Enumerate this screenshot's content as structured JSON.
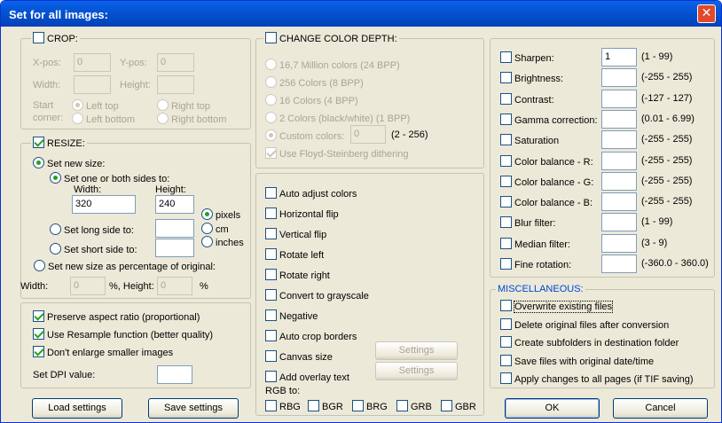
{
  "title": "Set for all images:",
  "close_glyph": "✕",
  "crop": {
    "label": "CROP:",
    "xpos_label": "X-pos:",
    "xpos": "0",
    "ypos_label": "Y-pos:",
    "ypos": "0",
    "width_label": "Width:",
    "height_label": "Height:",
    "start_label": "Start",
    "corner_label": "corner:",
    "left_top": "Left top",
    "right_top": "Right top",
    "left_bottom": "Left bottom",
    "right_bottom": "Right bottom"
  },
  "resize": {
    "label": "RESIZE:",
    "set_new_size": "Set new size:",
    "set_sides": "Set one or both sides to:",
    "width_label": "Width:",
    "height_label": "Height:",
    "width": "320",
    "height": "240",
    "pixels": "pixels",
    "cm": "cm",
    "inches": "inches",
    "long_side": "Set long side to:",
    "short_side": "Set short side to:",
    "percentage": "Set new size as percentage of original:",
    "pct_width_label": "Width:",
    "pct_width": "0",
    "pct_mid": "%, Height:",
    "pct_height": "0",
    "pct_end": "%"
  },
  "options": {
    "preserve": "Preserve aspect ratio (proportional)",
    "resample": "Use Resample function (better quality)",
    "dont_enlarge": "Don't enlarge smaller images",
    "dpi_label": "Set DPI value:"
  },
  "buttons": {
    "load": "Load settings",
    "save": "Save settings",
    "ok": "OK",
    "cancel": "Cancel",
    "settings1": "Settings",
    "settings2": "Settings"
  },
  "color_depth": {
    "label": "CHANGE COLOR DEPTH:",
    "c24": "16,7 Million colors (24 BPP)",
    "c8": "256 Colors (8 BPP)",
    "c4": "16 Colors (4 BPP)",
    "c1": "2 Colors (black/white) (1 BPP)",
    "custom": "Custom colors:",
    "custom_value": "0",
    "custom_range": "(2 - 256)",
    "dither": "Use Floyd-Steinberg dithering"
  },
  "transforms": {
    "auto_adjust": "Auto adjust colors",
    "hflip": "Horizontal flip",
    "vflip": "Vertical flip",
    "rot_left": "Rotate left",
    "rot_right": "Rotate right",
    "grayscale": "Convert to grayscale",
    "negative": "Negative",
    "autocrop": "Auto crop borders",
    "canvas": "Canvas size",
    "overlay": "Add overlay text",
    "rgb_label": "RGB to:",
    "rbg": "RBG",
    "bgr": "BGR",
    "brg": "BRG",
    "grb": "GRB",
    "gbr": "GBR"
  },
  "adjust": [
    {
      "label": "Sharpen:",
      "value": "1",
      "range": "(1 - 99)"
    },
    {
      "label": "Brightness:",
      "value": "",
      "range": "(-255 - 255)"
    },
    {
      "label": "Contrast:",
      "value": "",
      "range": "(-127 - 127)"
    },
    {
      "label": "Gamma correction:",
      "value": "",
      "range": "(0.01 - 6.99)"
    },
    {
      "label": "Saturation",
      "value": "",
      "range": "(-255 - 255)"
    },
    {
      "label": "Color balance - R:",
      "value": "",
      "range": "(-255 - 255)"
    },
    {
      "label": "Color balance - G:",
      "value": "",
      "range": "(-255 - 255)"
    },
    {
      "label": "Color balance - B:",
      "value": "",
      "range": "(-255 - 255)"
    },
    {
      "label": "Blur filter:",
      "value": "",
      "range": "(1 - 99)"
    },
    {
      "label": "Median filter:",
      "value": "",
      "range": "(3 - 9)"
    },
    {
      "label": "Fine rotation:",
      "value": "",
      "range": "(-360.0 - 360.0)"
    }
  ],
  "misc": {
    "label": "MISCELLANEOUS:",
    "overwrite": "Overwrite existing files",
    "delete": "Delete original files after conversion",
    "subfolders": "Create subfolders in destination folder",
    "save_date": "Save files with original date/time",
    "apply_pages": "Apply changes to all pages (if TIF saving)"
  }
}
